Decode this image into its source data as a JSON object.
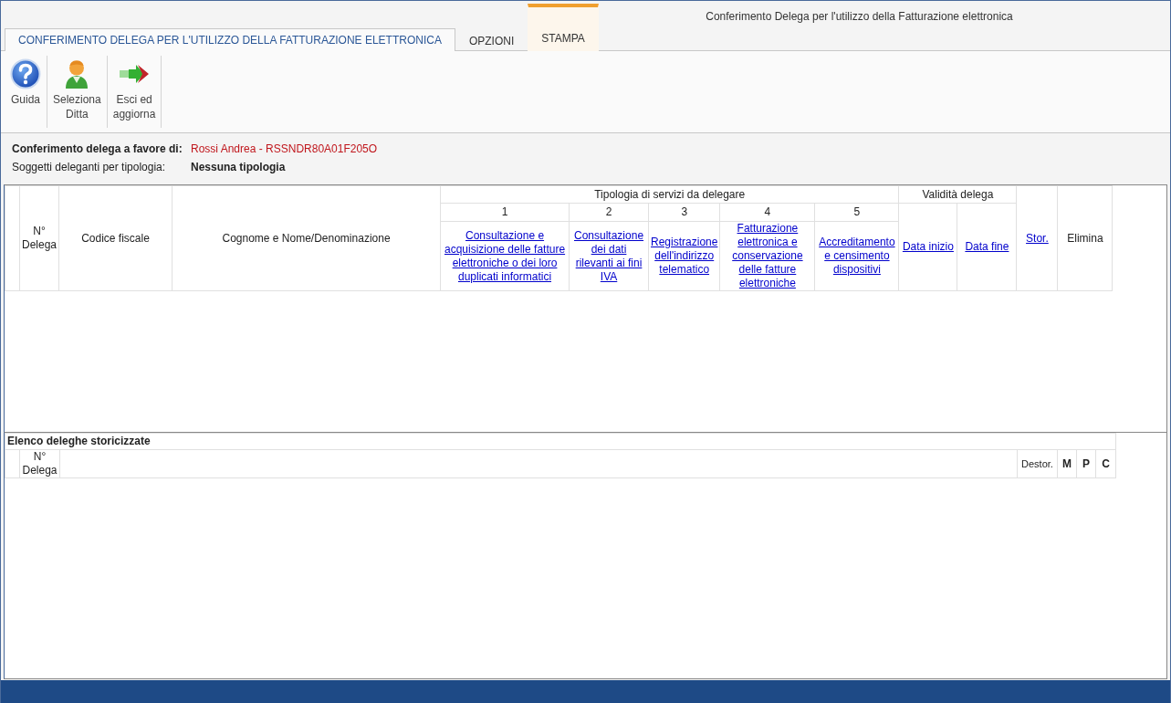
{
  "window": {
    "title": "Conferimento Delega per l'utilizzo della Fatturazione elettronica"
  },
  "tabs": [
    {
      "label": "CONFERIMENTO DELEGA PER L'UTILIZZO DELLA FATTURAZIONE ELETTRONICA",
      "selected": true,
      "kind": "normal"
    },
    {
      "label": "OPZIONI",
      "selected": false,
      "kind": "normal"
    },
    {
      "label": "STAMPA",
      "selected": false,
      "kind": "contextual"
    }
  ],
  "ribbon": [
    {
      "label": "Guida",
      "kind": "help"
    },
    {
      "label": "Seleziona\nDitta",
      "kind": "user"
    },
    {
      "label": "Esci ed\naggiorna",
      "kind": "exit"
    }
  ],
  "info": {
    "delegate_label": "Conferimento delega a favore di:",
    "delegate_value": "Rossi Andrea - RSSNDR80A01F205O",
    "type_label": "Soggetti deleganti per tipologia:",
    "type_value": "Nessuna tipologia"
  },
  "main_table": {
    "number": "N°\nDelega",
    "tax_code": "Codice fiscale",
    "name": "Cognome e Nome/Denominazione",
    "services_group": "Tipologia di servizi da delegare",
    "services": [
      {
        "number": "1",
        "label": "Consultazione e acquisizione delle fatture elettroniche o dei loro duplicati informatici"
      },
      {
        "number": "2",
        "label": "Consultazione dei dati rilevanti ai fini IVA"
      },
      {
        "number": "3",
        "label": "Registrazione dell'indirizzo telematico"
      },
      {
        "number": "4",
        "label": "Fatturazione elettronica e conservazione delle fatture elettroniche"
      },
      {
        "number": "5",
        "label": "Accreditamento e censimento dispositivi"
      }
    ],
    "validity_group": "Validità delega",
    "validity": [
      "Data inizio",
      "Data fine"
    ],
    "history": "Stor.",
    "delete": "Elimina"
  },
  "history_table": {
    "title": "Elenco deleghe storicizzate",
    "number": "N°\nDelega",
    "restore": "Destor.",
    "flags": [
      "M",
      "P",
      "C"
    ]
  }
}
